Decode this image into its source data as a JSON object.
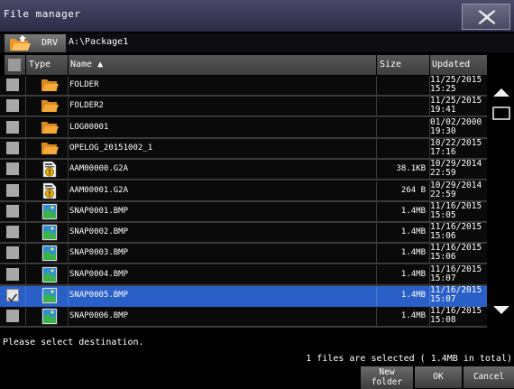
{
  "window": {
    "title": "File manager",
    "close_icon": "close-x-icon"
  },
  "pathbar": {
    "drive_label": "DRV",
    "path": "A:\\Package1"
  },
  "columns": {
    "type": "Type",
    "name": "Name ▲",
    "size": "Size",
    "updated": "Updated"
  },
  "rows": [
    {
      "icon": "folder-icon",
      "name": "FOLDER",
      "size": "",
      "date": "11/25/2015",
      "time": "15:25",
      "checked": false,
      "selected": false
    },
    {
      "icon": "folder-icon",
      "name": "FOLDER2",
      "size": "",
      "date": "11/25/2015",
      "time": "19:41",
      "checked": false,
      "selected": false
    },
    {
      "icon": "folder-icon",
      "name": "LOG00001",
      "size": "",
      "date": "01/02/2000",
      "time": "19:30",
      "checked": false,
      "selected": false
    },
    {
      "icon": "folder-icon",
      "name": "OPELOG_20151002_1",
      "size": "",
      "date": "10/22/2015",
      "time": "17:16",
      "checked": false,
      "selected": false
    },
    {
      "icon": "alarm-file-icon",
      "name": "AAM00000.G2A",
      "size": "38.1KB",
      "date": "10/29/2014",
      "time": "22:59",
      "checked": false,
      "selected": false
    },
    {
      "icon": "alarm-file-icon",
      "name": "AAM00001.G2A",
      "size": "264 B",
      "date": "10/29/2014",
      "time": "22:59",
      "checked": false,
      "selected": false
    },
    {
      "icon": "image-file-icon",
      "name": "SNAP0001.BMP",
      "size": "1.4MB",
      "date": "11/16/2015",
      "time": "15:05",
      "checked": false,
      "selected": false
    },
    {
      "icon": "image-file-icon",
      "name": "SNAP0002.BMP",
      "size": "1.4MB",
      "date": "11/16/2015",
      "time": "15:06",
      "checked": false,
      "selected": false
    },
    {
      "icon": "image-file-icon",
      "name": "SNAP0003.BMP",
      "size": "1.4MB",
      "date": "11/16/2015",
      "time": "15:06",
      "checked": false,
      "selected": false
    },
    {
      "icon": "image-file-icon",
      "name": "SNAP0004.BMP",
      "size": "1.4MB",
      "date": "11/16/2015",
      "time": "15:07",
      "checked": false,
      "selected": false
    },
    {
      "icon": "image-file-icon",
      "name": "SNAP0005.BMP",
      "size": "1.4MB",
      "date": "11/16/2015",
      "time": "15:07",
      "checked": true,
      "selected": true
    },
    {
      "icon": "image-file-icon",
      "name": "SNAP0006.BMP",
      "size": "1.4MB",
      "date": "11/16/2015",
      "time": "15:08",
      "checked": false,
      "selected": false
    }
  ],
  "scrollbar": {
    "up_icon": "triangle-up-icon",
    "page_icon": "page-box-icon",
    "down_icon": "triangle-down-icon"
  },
  "status": {
    "message": "Please select destination.",
    "selection_summary": "1 files are selected ( 1.4MB in total)"
  },
  "buttons": {
    "new_folder_line1": "New",
    "new_folder_line2": "folder",
    "ok": "OK",
    "cancel": "Cancel"
  },
  "colors": {
    "title_bar": "#3b3a58",
    "selected_row": "#2a5fc7",
    "folder": "#f0a030",
    "checkbox": "#a8a8a8"
  }
}
